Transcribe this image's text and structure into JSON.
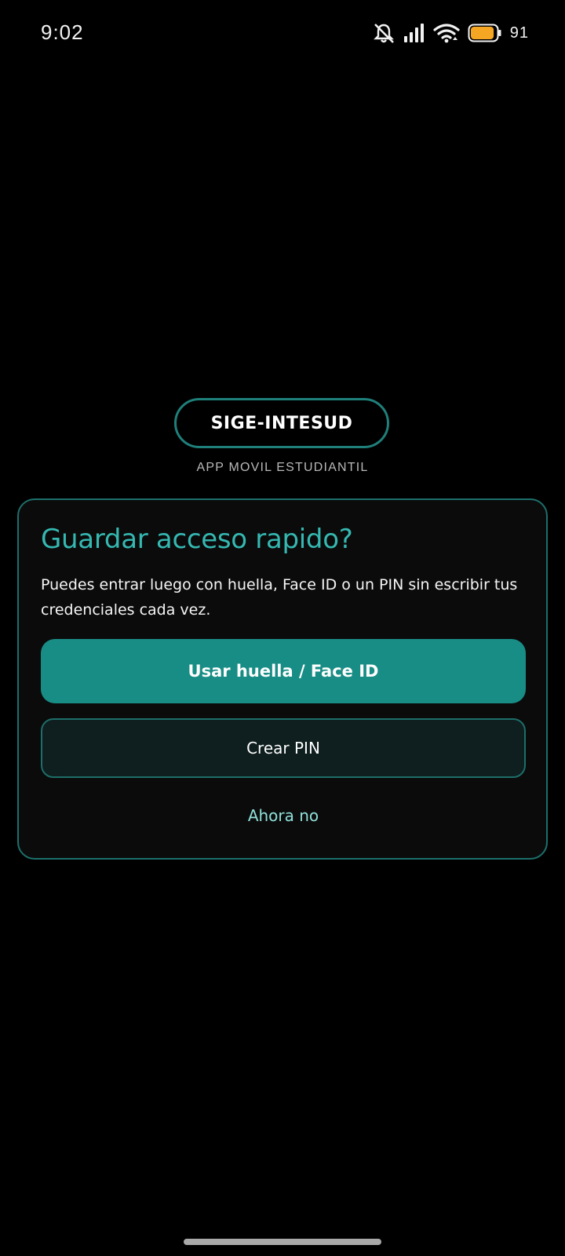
{
  "status_bar": {
    "time": "9:02",
    "icons": [
      "mute-icon",
      "signal-icon",
      "wifi-icon",
      "battery-icon"
    ],
    "battery_percent": "91",
    "battery_color": "#f5a623"
  },
  "brand": {
    "name": "SIGE-INTESUD",
    "subtitle": "APP MOVIL ESTUDIANTIL"
  },
  "dialog": {
    "title": "Guardar acceso rapido?",
    "body": "Puedes entrar luego con huella, Face ID o un PIN sin escribir tus credenciales cada vez.",
    "primary_label": "Usar huella / Face ID",
    "secondary_label": "Crear PIN",
    "dismiss_label": "Ahora no"
  },
  "colors": {
    "accent": "#35b8b1",
    "primary_button": "#188d85",
    "outline": "#1d6f6b",
    "link": "#8fe0d9"
  }
}
